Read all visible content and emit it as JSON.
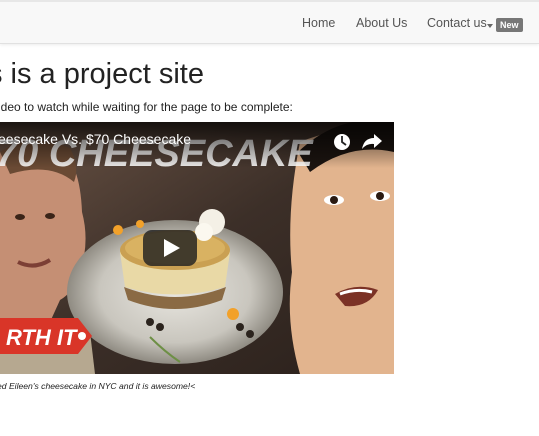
{
  "nav": {
    "home": "Home",
    "about": "About Us",
    "contact": "Contact us",
    "badge": "New"
  },
  "page": {
    "title": "s is a project site",
    "intro": "ideo to watch while waiting for the page to be complete:"
  },
  "video": {
    "title": "eesecake Vs. $70 Cheesecake",
    "banner_text": "70 CHEESECAKE",
    "tag_text": "RTH IT",
    "watch_later_icon": "clock-icon",
    "share_icon": "share-icon",
    "play_icon": "play-icon"
  },
  "caption": "ed Eileen's cheesecake in NYC and it is awesome!<"
}
